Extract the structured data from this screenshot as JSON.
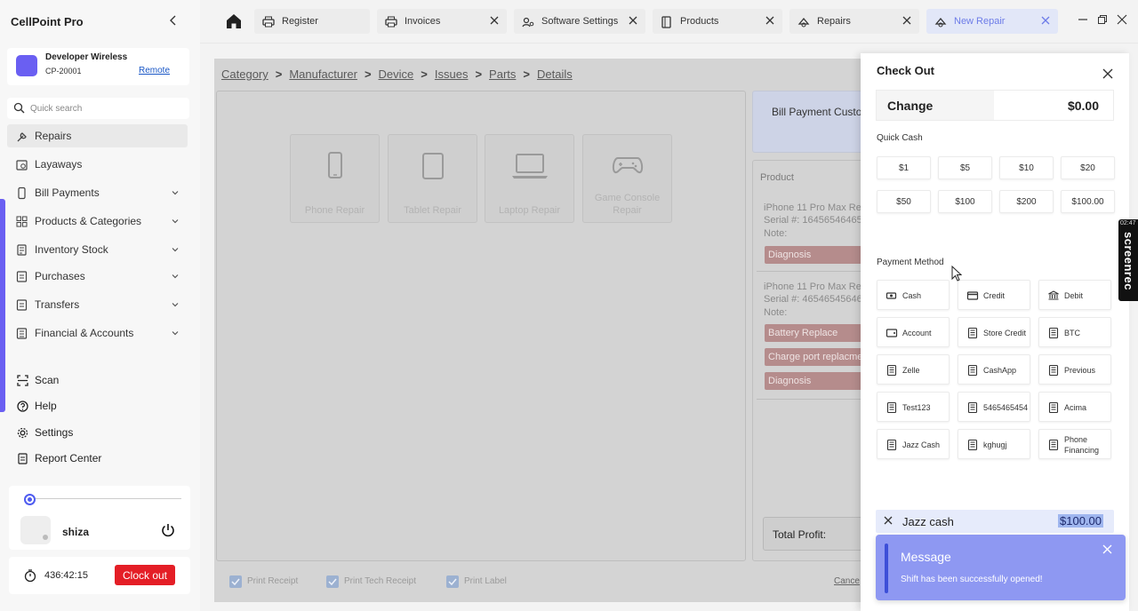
{
  "app": {
    "title": "CellPoint Pro"
  },
  "store": {
    "name": "Developer Wireless",
    "code": "CP-20001",
    "remote_link": "Remote"
  },
  "search": {
    "placeholder": "Quick search"
  },
  "nav": [
    {
      "label": "Repairs",
      "icon": "wrench-icon",
      "active": true
    },
    {
      "label": "Layaways",
      "icon": "calendar-icon"
    },
    {
      "label": "Bill Payments",
      "icon": "phone-icon"
    },
    {
      "label": "Products & Categories",
      "icon": "grid-icon"
    },
    {
      "label": "Inventory Stock",
      "icon": "list-icon"
    },
    {
      "label": "Purchases",
      "icon": "cart-icon"
    },
    {
      "label": "Transfers",
      "icon": "transfer-icon"
    },
    {
      "label": "Financial & Accounts",
      "icon": "ledger-icon"
    }
  ],
  "bottom_nav": [
    {
      "label": "Scan",
      "icon": "scan-icon"
    },
    {
      "label": "Help",
      "icon": "help-icon"
    },
    {
      "label": "Settings",
      "icon": "gear-icon"
    },
    {
      "label": "Report Center",
      "icon": "report-icon"
    }
  ],
  "user": {
    "name": "shiza",
    "timer": "436:42:15",
    "clock_out": "Clock out"
  },
  "tabs": [
    {
      "label": "Register",
      "icon": "printer-icon",
      "closable": false
    },
    {
      "label": "Invoices",
      "icon": "printer-icon",
      "closable": true
    },
    {
      "label": "Software Settings",
      "icon": "settings-icon",
      "closable": true
    },
    {
      "label": "Products",
      "icon": "product-icon",
      "closable": true
    },
    {
      "label": "Repairs",
      "icon": "repair-icon",
      "closable": true
    },
    {
      "label": "New Repair",
      "icon": "repair-icon",
      "closable": true,
      "active": true
    }
  ],
  "breadcrumb": [
    "Category",
    "Manufacturer",
    "Device",
    "Issues",
    "Parts",
    "Details"
  ],
  "categories": [
    {
      "label": "Phone Repair",
      "icon": "smartphone-icon"
    },
    {
      "label": "Tablet Repair",
      "icon": "tablet-icon"
    },
    {
      "label": "Laptop Repair",
      "icon": "laptop-icon"
    },
    {
      "label": "Game Console Repair",
      "icon": "gamepad-icon"
    }
  ],
  "bill_payment": "Bill Payment Custo",
  "products": {
    "header": "Product",
    "items": [
      {
        "title": "iPhone 11 Pro Max Rep",
        "serial": "Serial #: 16456546465",
        "note": "Note:",
        "issues": [
          "Diagnosis"
        ]
      },
      {
        "title": "iPhone 11 Pro Max Rep",
        "serial": "Serial #: 46546545646",
        "note": "Note:",
        "issues": [
          "Battery Replace",
          "Charge port replacme",
          "Diagnosis"
        ]
      }
    ],
    "total_profit": "Total Profit:"
  },
  "print_options": [
    "Print Receipt",
    "Print Tech Receipt",
    "Print Label"
  ],
  "cancel": "Cance",
  "checkout": {
    "title": "Check Out",
    "change_label": "Change",
    "change_value": "$0.00",
    "quick_cash_title": "Quick Cash",
    "quick_cash": [
      "$1",
      "$5",
      "$10",
      "$20",
      "$50",
      "$100",
      "$200",
      "$100.00"
    ],
    "payment_method_title": "Payment Method",
    "methods": [
      {
        "label": "Cash",
        "icon": "cash-icon"
      },
      {
        "label": "Credit",
        "icon": "credit-card-icon"
      },
      {
        "label": "Debit",
        "icon": "bank-icon"
      },
      {
        "label": "Account",
        "icon": "wallet-icon"
      },
      {
        "label": "Store Credit",
        "icon": "receipt-icon"
      },
      {
        "label": "BTC",
        "icon": "receipt-icon"
      },
      {
        "label": "Zelle",
        "icon": "receipt-icon"
      },
      {
        "label": "CashApp",
        "icon": "receipt-icon"
      },
      {
        "label": "Previous",
        "icon": "receipt-icon"
      },
      {
        "label": "Test123",
        "icon": "receipt-icon"
      },
      {
        "label": "5465465454",
        "icon": "receipt-icon"
      },
      {
        "label": "Acima",
        "icon": "receipt-icon"
      },
      {
        "label": "Jazz Cash",
        "icon": "receipt-icon"
      },
      {
        "label": "kghugj",
        "icon": "receipt-icon"
      },
      {
        "label": "Phone Financing",
        "icon": "receipt-icon"
      }
    ],
    "selected_method": "Jazz cash",
    "selected_amount": "$100.00"
  },
  "toast": {
    "title": "Message",
    "message": "Shift has been successfully opened!"
  },
  "screenrec": {
    "time": "02:47",
    "label": "screenrec"
  },
  "colors": {
    "accent": "#6a5ff2",
    "danger": "#e41e26",
    "toast": "#8e98f2",
    "issue_chip": "#b58c8c"
  }
}
